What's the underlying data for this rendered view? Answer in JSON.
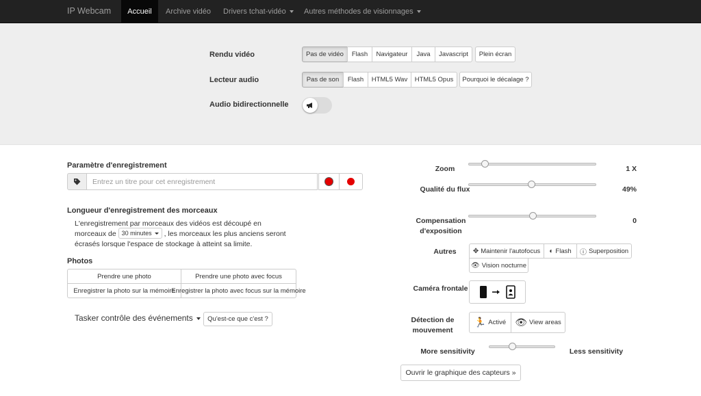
{
  "nav": {
    "brand": "IP Webcam",
    "items": [
      {
        "label": "Accueil"
      },
      {
        "label": "Archive vidéo"
      },
      {
        "label": "Drivers tchat-vidéo"
      },
      {
        "label": "Autres méthodes de visionnages"
      }
    ]
  },
  "top": {
    "video_label": "Rendu vidéo",
    "video_options": [
      "Pas de vidéo",
      "Flash",
      "Navigateur",
      "Java",
      "Javascript"
    ],
    "fullscreen": "Plein écran",
    "audio_label": "Lecteur audio",
    "audio_options": [
      "Pas de son",
      "Flash",
      "HTML5 Wav",
      "HTML5 Opus"
    ],
    "delay_help": "Pourquoi le décalage ?",
    "bidirectional_label": "Audio bidirectionnelle"
  },
  "record": {
    "heading": "Paramètre d'enregistrement",
    "title_placeholder": "Entrez un titre pour cet enregistrement",
    "chunk_heading": "Longueur d'enregistrement des morceaux",
    "chunk_text_1": "L'enregistrement par morceaux des vidéos est découpé en",
    "chunk_text_2a": "morceaux de",
    "chunk_select": "30 minutes",
    "chunk_text_2b": ", les morceaux les plus anciens seront",
    "chunk_text_3": "écrasés lorsque l'espace de stockage à atteint sa limite."
  },
  "photos": {
    "heading": "Photos",
    "take": "Prendre une photo",
    "take_focus": "Prendre une photo avec focus",
    "save": "Enregistrer la photo sur la mémoire",
    "save_focus": "Enregistrer la photo avec focus sur la mémoire"
  },
  "tasker": {
    "label": "Tasker contrôle des événements",
    "help": "Qu'est-ce que c'est ?"
  },
  "controls": {
    "zoom_label": "Zoom",
    "zoom_value": "1 X",
    "zoom_fraction": 0.1,
    "quality_label": "Qualité du flux",
    "quality_value": "49%",
    "quality_fraction": 0.49,
    "exposure_label": "Compensation d'exposition",
    "exposure_value": "0",
    "exposure_fraction": 0.5,
    "others_label": "Autres",
    "autofocus": "Maintenir l'autofocus",
    "flash": "Flash",
    "overlay": "Superposition",
    "night_vision": "Vision nocturne",
    "front_camera_label": "Caméra frontale",
    "motion_label": "Détection de mouvement",
    "motion_active": "Activé",
    "view_areas": "View areas",
    "more_sensitivity": "More sensitivity",
    "less_sensitivity": "Less sensitivity",
    "sensitivity_fraction": 0.33,
    "sensor_graph": "Ouvrir le graphique des capteurs »"
  }
}
